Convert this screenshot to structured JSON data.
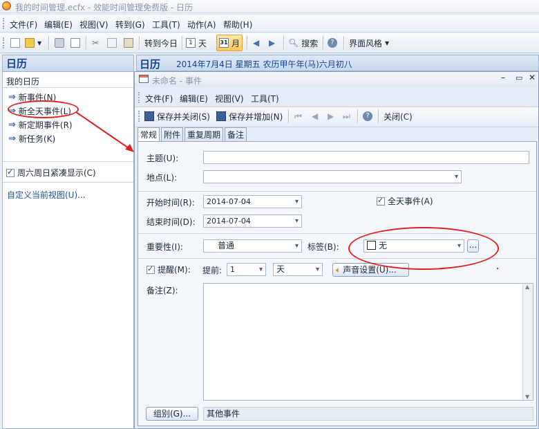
{
  "window": {
    "title": "我的时间管理.ecfx - 效能时间管理免费版 - 日历"
  },
  "menubar": {
    "items": [
      "文件(F)",
      "编辑(E)",
      "视图(V)",
      "转到(G)",
      "工具(T)",
      "动作(A)",
      "帮助(H)"
    ]
  },
  "toolbar": {
    "today_label": "转到今日",
    "day_label": "天",
    "month_label": "月",
    "day_icon_number": "1",
    "month_icon_number": "31",
    "search_label": "搜索",
    "theme_label": "界面风格"
  },
  "sidebar": {
    "header": "日历",
    "my_calendar": "我的日历",
    "items": [
      {
        "label": "新事件(N)"
      },
      {
        "label": "新全天事件(L)"
      },
      {
        "label": "新定期事件(R)"
      },
      {
        "label": "新任务(K)"
      }
    ],
    "compact_weekend": "周六周日紧凑显示(C)",
    "customize_view": "自定义当前视图(U)..."
  },
  "calendar": {
    "header_prefix": "日历",
    "date_text": "2014年7月4日 星期五 农历甲午年(马)六月初八"
  },
  "dialog": {
    "title": "未命名 - 事件",
    "menu": [
      "文件(F)",
      "编辑(E)",
      "视图(V)",
      "工具(T)"
    ],
    "toolbar": {
      "save_close": "保存并关闭(S)",
      "save_add": "保存并增加(N)",
      "close": "关闭(C)"
    },
    "tabs": [
      "常规",
      "附件",
      "重复周期",
      "备注"
    ],
    "form": {
      "subject_label": "主题(U):",
      "subject_value": "",
      "location_label": "地点(L):",
      "location_value": "",
      "start_label": "开始时间(R):",
      "start_value": "2014-07-04",
      "end_label": "结束时间(D):",
      "end_value": "2014-07-04",
      "allday_label": "全天事件(A)",
      "allday_checked": true,
      "importance_label": "重要性(I):",
      "importance_value": "普通",
      "tag_label": "标签(B):",
      "tag_value": "无",
      "tag_more": "...",
      "reminder_label": "提醒(M):",
      "reminder_checked": true,
      "advance_label": "提前:",
      "advance_value": "1",
      "advance_unit": "天",
      "sound_button": "声音设置(U)...",
      "notes_label": "备注(Z):",
      "group_button": "组别(G)...",
      "group_value": "其他事件"
    }
  },
  "colors": {
    "annotation": "#e02020",
    "accent": "#15428b"
  }
}
